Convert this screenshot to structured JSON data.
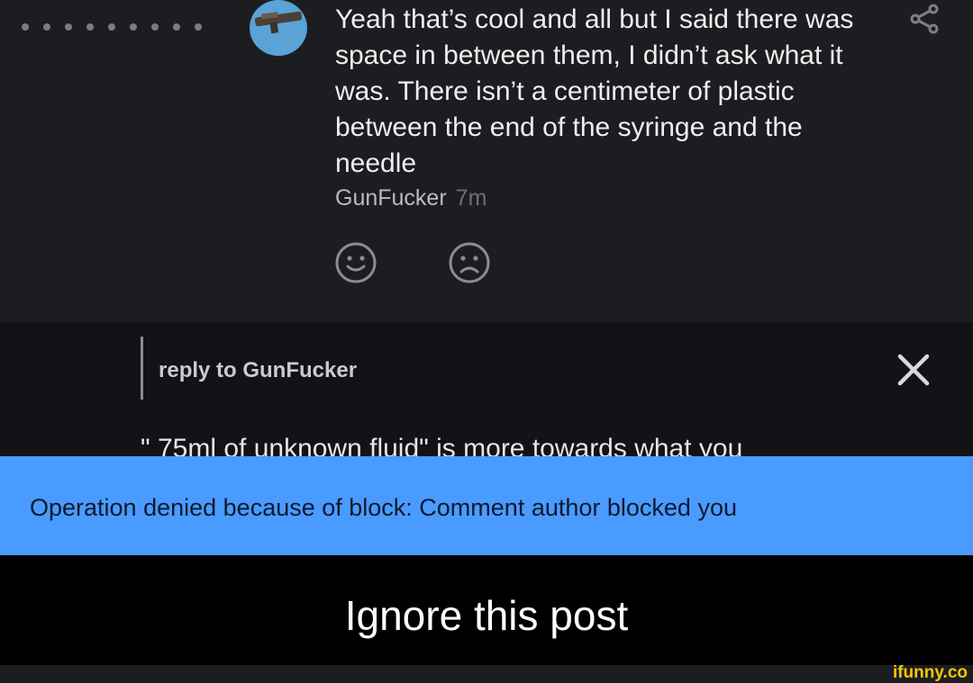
{
  "comment": {
    "text": "Yeah that’s cool and all but I said there was space in between them, I didn’t ask what it was. There isn’t a centimeter of plastic between the end of the syringe and the needle",
    "author": "GunFucker",
    "time": "7m",
    "avatar_color": "#5a9fcf",
    "icons": [
      "thread-dots-icon",
      "share-icon",
      "smile-icon",
      "frown-icon"
    ]
  },
  "reply": {
    "label": "reply to GunFucker",
    "draft": "\" 75ml of unknown fluid\" is more towards what you",
    "close_icon": "close-icon"
  },
  "toast": {
    "message": "Operation denied because of block: Comment author blocked you",
    "color": "#4a9bff"
  },
  "caption": "Ignore this post",
  "watermark": "ifunny.co",
  "watermark_color": "#f5c700"
}
